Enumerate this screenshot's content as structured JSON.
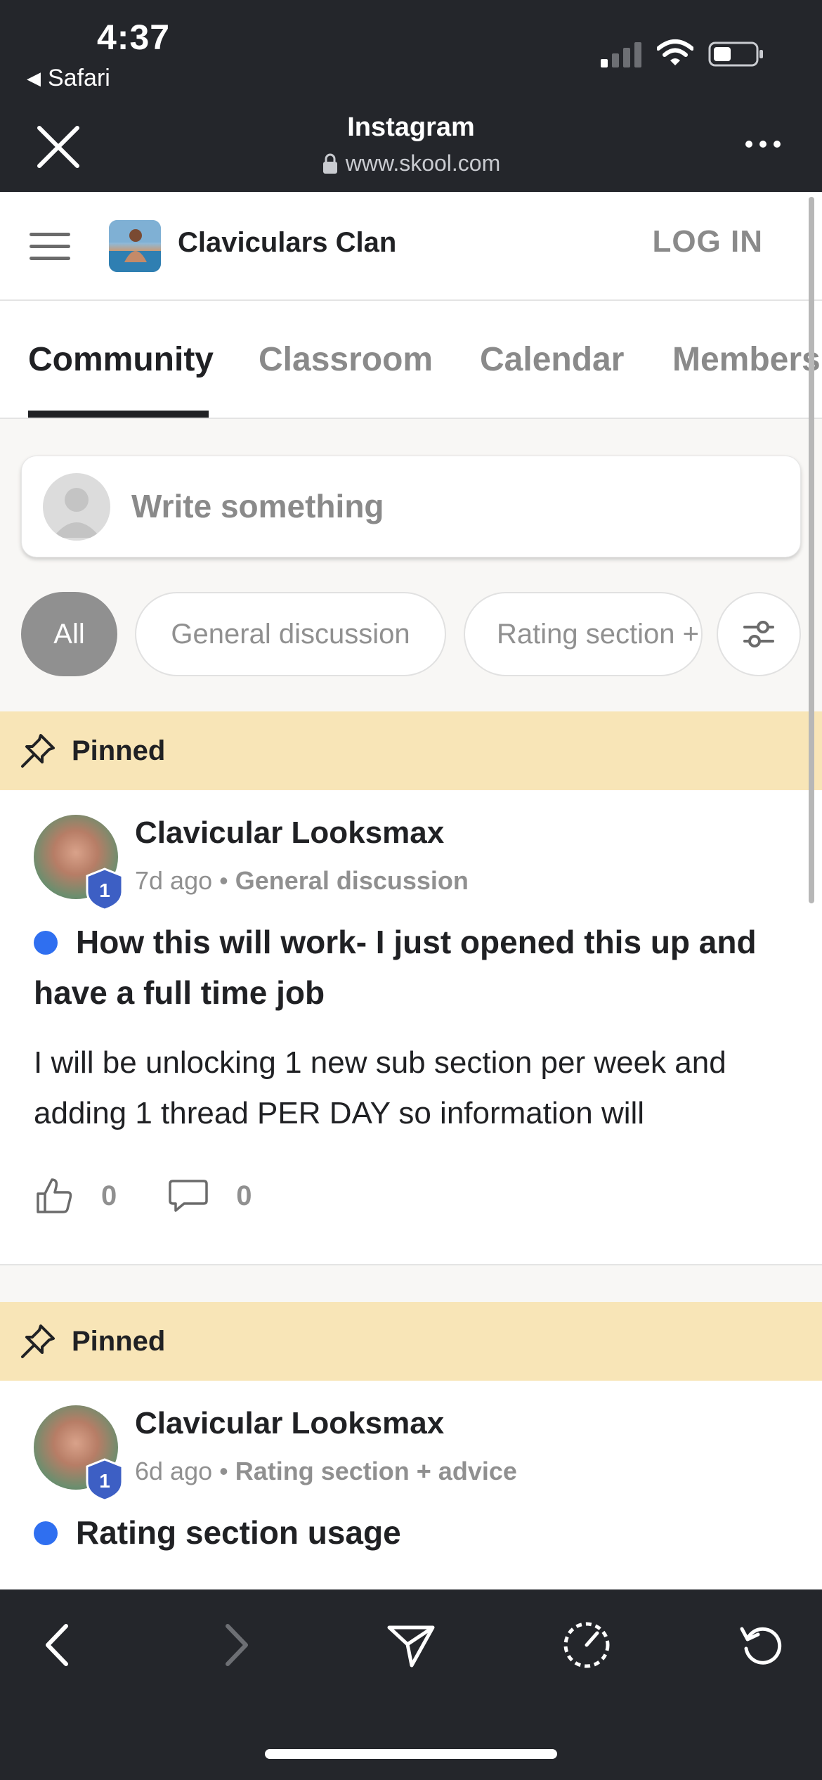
{
  "status_bar": {
    "time": "4:37",
    "back_app": "Safari"
  },
  "browser": {
    "tab_title": "Instagram",
    "url": "www.skool.com"
  },
  "header": {
    "group_name": "Claviculars Clan",
    "login_label": "LOG IN"
  },
  "tabs": [
    {
      "label": "Community",
      "active": true
    },
    {
      "label": "Classroom",
      "active": false
    },
    {
      "label": "Calendar",
      "active": false
    },
    {
      "label": "Members",
      "active": false
    }
  ],
  "composer": {
    "placeholder": "Write something"
  },
  "filters": {
    "all": "All",
    "general": "General discussion",
    "rating": "Rating section + advice"
  },
  "posts": [
    {
      "pinned_label": "Pinned",
      "author": "Clavicular Looksmax",
      "level": "1",
      "time_ago": "7d ago",
      "separator": "•",
      "category": "General discussion",
      "title": "How this will work- I just opened this up and have a full time job",
      "body": "I will be unlocking 1 new sub section per week and adding 1 thread PER DAY so information will",
      "likes": "0",
      "comments": "0"
    },
    {
      "pinned_label": "Pinned",
      "author": "Clavicular Looksmax",
      "level": "1",
      "time_ago": "6d ago",
      "separator": "•",
      "category": "Rating section + advice",
      "title": "Rating section usage"
    }
  ],
  "colors": {
    "chrome_dark": "#24262b",
    "pinned_bg": "#f8e5b7",
    "unread_dot": "#2f6ff0",
    "level_badge": "#3d5fc4"
  }
}
